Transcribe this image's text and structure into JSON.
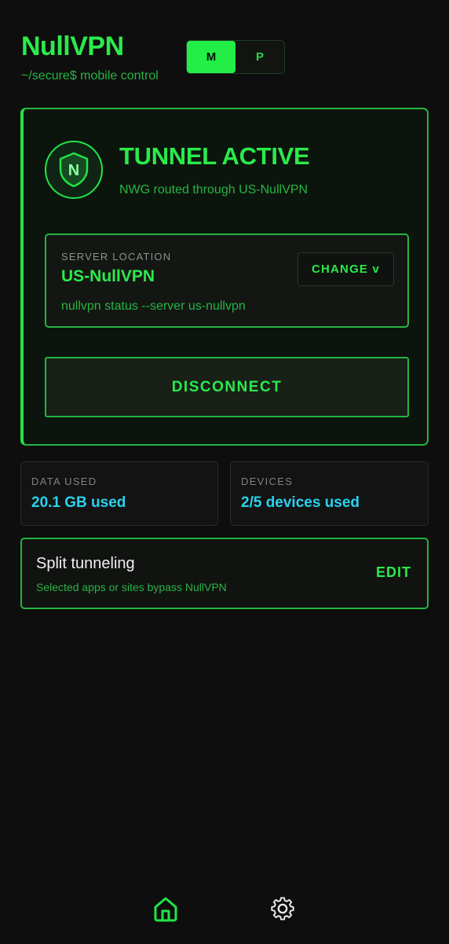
{
  "app": {
    "title": "NullVPN",
    "subtitle": "~/secure$ mobile control"
  },
  "mode_toggle": {
    "options": [
      "M",
      "P"
    ],
    "selected": "M"
  },
  "status": {
    "icon": "shield-n-icon",
    "shield_letter": "N",
    "title": "TUNNEL ACTIVE",
    "subtitle": "NWG routed through US-NullVPN",
    "server": {
      "label": "SERVER LOCATION",
      "name": "US-NullVPN",
      "command": "nullvpn status --server us-nullvpn",
      "change_label": "CHANGE v"
    },
    "disconnect_label": "DISCONNECT"
  },
  "stats": [
    {
      "label": "DATA USED",
      "value": "20.1 GB used"
    },
    {
      "label": "DEVICES",
      "value": "2/5 devices used"
    }
  ],
  "split_tunneling": {
    "title": "Split tunneling",
    "subtitle": "Selected apps or sites bypass NullVPN",
    "edit_label": "EDIT"
  },
  "nav": {
    "items": [
      {
        "icon": "home-icon",
        "active": true
      },
      {
        "icon": "gear-icon",
        "active": false
      }
    ]
  },
  "colors": {
    "accent": "#2bea4b",
    "accent_dim": "#27b443",
    "info": "#29d2f0",
    "background": "#0d0e0d"
  }
}
